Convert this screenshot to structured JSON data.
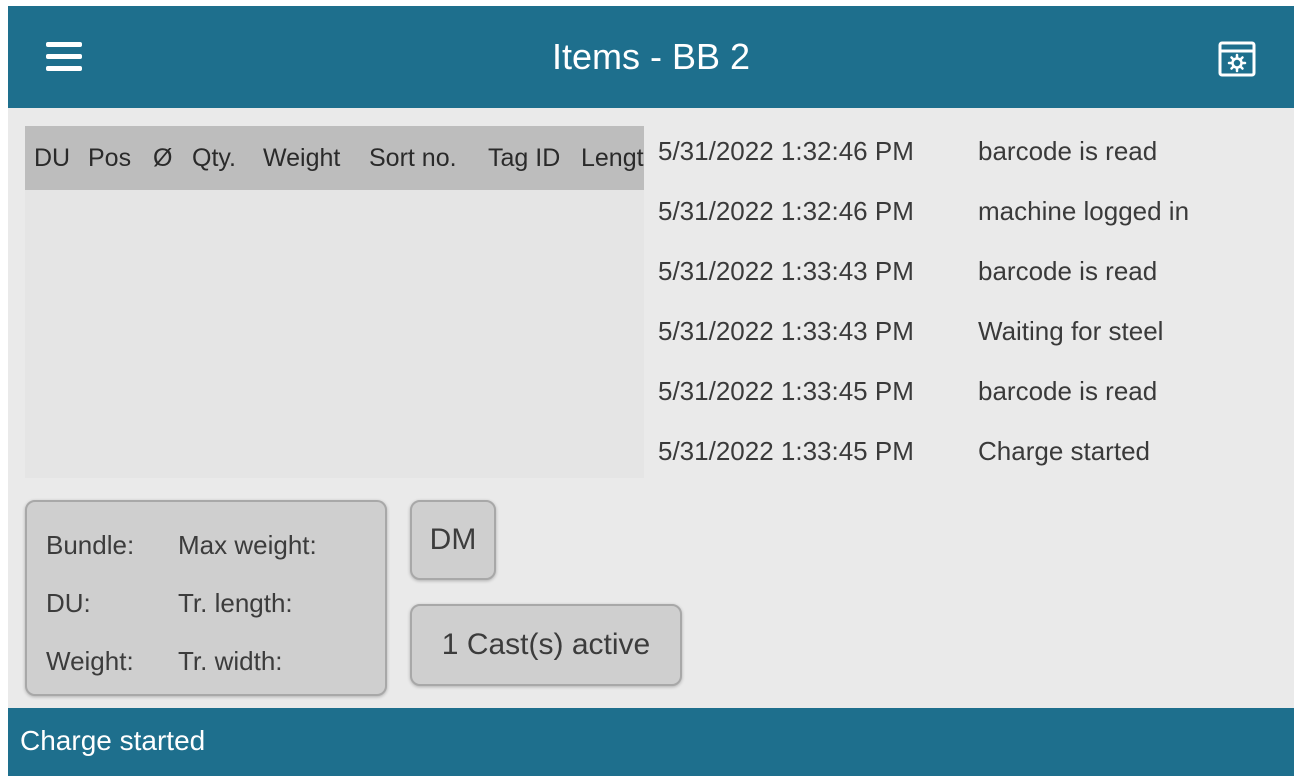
{
  "header": {
    "title": "Items - BB 2"
  },
  "table": {
    "columns": [
      "DU",
      "Pos",
      "Ø",
      "Qty.",
      "Weight",
      "Sort no.",
      "Tag ID",
      "Length"
    ],
    "rows": []
  },
  "log": [
    {
      "timestamp": "5/31/2022 1:32:46 PM",
      "message": "barcode is read"
    },
    {
      "timestamp": "5/31/2022 1:32:46 PM",
      "message": "machine logged in"
    },
    {
      "timestamp": "5/31/2022 1:33:43 PM",
      "message": "barcode is read"
    },
    {
      "timestamp": "5/31/2022 1:33:43 PM",
      "message": "Waiting for steel"
    },
    {
      "timestamp": "5/31/2022 1:33:45 PM",
      "message": "barcode is read"
    },
    {
      "timestamp": "5/31/2022 1:33:45 PM",
      "message": "Charge started"
    }
  ],
  "info": {
    "bundle_label": "Bundle:",
    "du_label": "DU:",
    "weight_label": "Weight:",
    "max_weight_label": "Max weight:",
    "tr_length_label": "Tr. length:",
    "tr_width_label": "Tr. width:"
  },
  "buttons": {
    "dm_label": "DM",
    "cast_label": "1 Cast(s) active"
  },
  "status": {
    "text": "Charge started"
  },
  "colors": {
    "bar": "#1e6f8d",
    "background": "#eaeaea",
    "table_header": "#bdbdbd",
    "panel": "#cfcfcf"
  },
  "icons": {
    "menu": "hamburger-menu-icon",
    "settings": "settings-window-icon"
  }
}
